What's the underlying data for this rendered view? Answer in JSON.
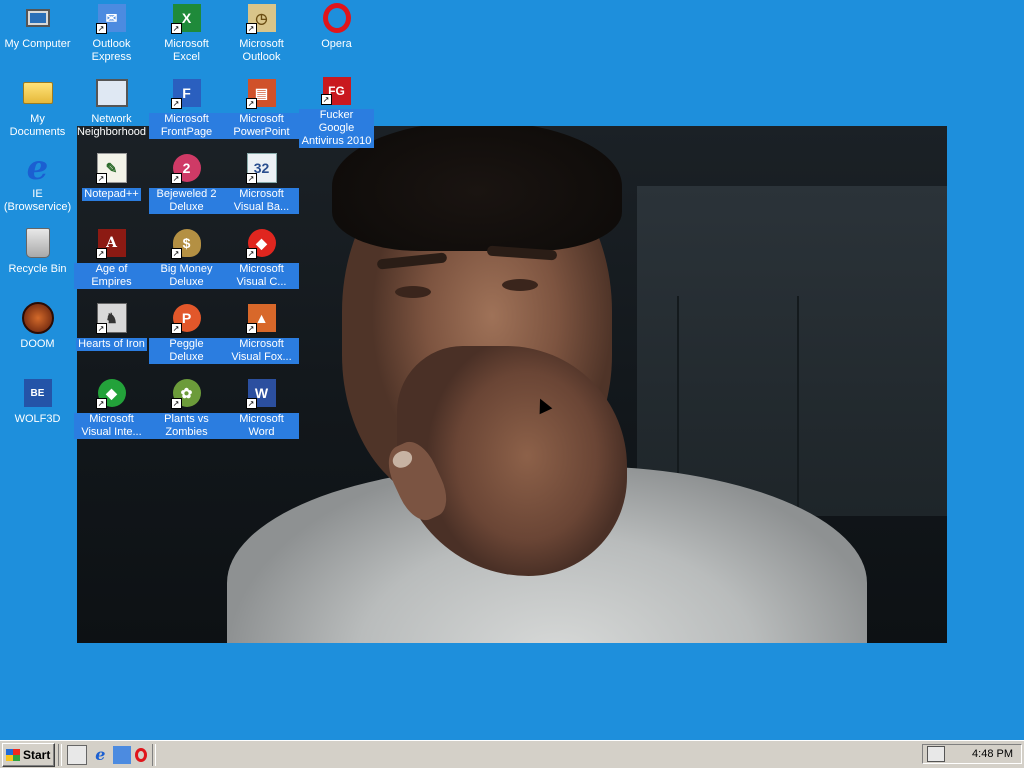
{
  "desktop": {
    "icons": [
      {
        "id": "my-computer",
        "label": "My Computer",
        "glyph": "monitor-icon",
        "shortcut": false,
        "selected": false
      },
      {
        "id": "my-documents",
        "label": "My Documents",
        "glyph": "folder-icon",
        "shortcut": false,
        "selected": false
      },
      {
        "id": "ie",
        "label": "IE (Browservice)",
        "glyph": "internet-explorer-icon",
        "shortcut": false,
        "selected": false
      },
      {
        "id": "recycle-bin",
        "label": "Recycle Bin",
        "glyph": "recycle-bin-icon",
        "shortcut": false,
        "selected": false
      },
      {
        "id": "doom",
        "label": "DOOM",
        "glyph": "doom-icon",
        "shortcut": false,
        "selected": false
      },
      {
        "id": "wolf3d",
        "label": "WOLF3D",
        "glyph": "wolf3d-icon",
        "shortcut": false,
        "selected": false
      },
      {
        "id": "outlook-express",
        "label": "Outlook Express",
        "glyph": "outlook-express-icon",
        "shortcut": true,
        "selected": false
      },
      {
        "id": "network",
        "label": "Network Neighborhood",
        "glyph": "network-icon",
        "shortcut": false,
        "selected": false
      },
      {
        "id": "notepadpp",
        "label": "Notepad++",
        "glyph": "notepad-icon",
        "shortcut": true,
        "selected": true
      },
      {
        "id": "aoe",
        "label": "Age of Empires",
        "glyph": "age-of-empires-icon",
        "shortcut": true,
        "selected": true
      },
      {
        "id": "hoi",
        "label": "Hearts of Iron",
        "glyph": "hearts-of-iron-icon",
        "shortcut": true,
        "selected": true
      },
      {
        "id": "vi",
        "label": "Microsoft Visual Inte...",
        "glyph": "visual-interdev-icon",
        "shortcut": true,
        "selected": true
      },
      {
        "id": "excel",
        "label": "Microsoft Excel",
        "glyph": "excel-icon",
        "shortcut": true,
        "selected": false
      },
      {
        "id": "frontpage",
        "label": "Microsoft FrontPage",
        "glyph": "frontpage-icon",
        "shortcut": true,
        "selected": true
      },
      {
        "id": "bejeweled",
        "label": "Bejeweled 2 Deluxe",
        "glyph": "bejeweled-icon",
        "shortcut": true,
        "selected": true
      },
      {
        "id": "bigmoney",
        "label": "Big Money Deluxe",
        "glyph": "money-bag-icon",
        "shortcut": true,
        "selected": true
      },
      {
        "id": "peggle",
        "label": "Peggle Deluxe",
        "glyph": "peggle-icon",
        "shortcut": true,
        "selected": true
      },
      {
        "id": "pvz",
        "label": "Plants vs Zombies",
        "glyph": "plants-vs-zombies-icon",
        "shortcut": true,
        "selected": true
      },
      {
        "id": "outlook",
        "label": "Microsoft Outlook",
        "glyph": "outlook-icon",
        "shortcut": true,
        "selected": false
      },
      {
        "id": "powerpoint",
        "label": "Microsoft PowerPoint",
        "glyph": "powerpoint-icon",
        "shortcut": true,
        "selected": true
      },
      {
        "id": "vb",
        "label": "Microsoft Visual Ba...",
        "glyph": "visual-basic-icon",
        "shortcut": true,
        "selected": true
      },
      {
        "id": "vc",
        "label": "Microsoft Visual C...",
        "glyph": "visual-cpp-icon",
        "shortcut": true,
        "selected": true
      },
      {
        "id": "vfox",
        "label": "Microsoft Visual Fox...",
        "glyph": "visual-foxpro-icon",
        "shortcut": true,
        "selected": true
      },
      {
        "id": "word",
        "label": "Microsoft Word",
        "glyph": "word-icon",
        "shortcut": true,
        "selected": true
      },
      {
        "id": "opera",
        "label": "Opera",
        "glyph": "opera-icon",
        "shortcut": false,
        "selected": false
      },
      {
        "id": "fg",
        "label": "Fucker Google Antivirus 2010",
        "glyph": "fg-antivirus-icon",
        "shortcut": true,
        "selected": true
      }
    ],
    "background_color": "#1e8fdc",
    "selection_color": "#2b7de0"
  },
  "taskbar": {
    "start_label": "Start",
    "quick_launch": [
      "show-desktop-icon",
      "internet-explorer-icon",
      "outlook-express-icon",
      "opera-icon"
    ],
    "clock": "4:48 PM"
  }
}
